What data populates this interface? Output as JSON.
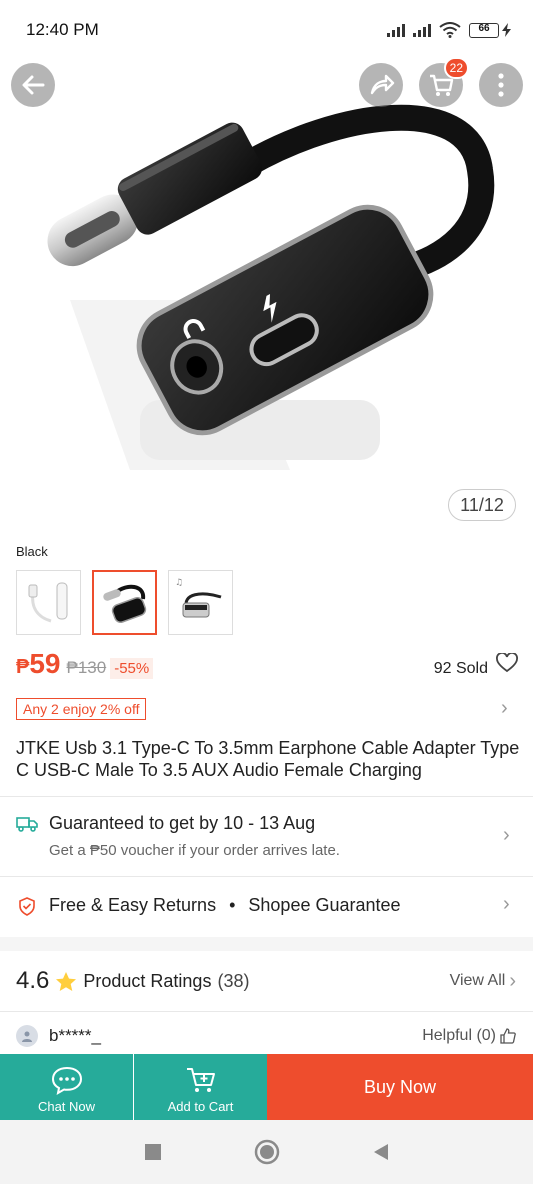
{
  "status_bar": {
    "time": "12:40 PM",
    "battery": "66"
  },
  "hero": {
    "cart_count": "22",
    "image_counter": "11/12",
    "image_subject": "usb-c to 3.5mm audio adapter with charging port (black)"
  },
  "variant": {
    "label": "Black",
    "options": [
      "white",
      "black",
      "silver"
    ],
    "selected_index": 1
  },
  "price": {
    "currency": "₱",
    "current": "59",
    "original": "₱130",
    "discount": "-55%",
    "sold": "92 Sold"
  },
  "promo": {
    "text": "Any 2 enjoy 2% off"
  },
  "product": {
    "title": "JTKE Usb 3.1 Type-C To 3.5mm Earphone Cable Adapter Type C USB-C Male To 3.5 AUX Audio Female Charging"
  },
  "shipping": {
    "title": "Guaranteed to get by 10 - 13 Aug",
    "subtitle": "Get a ₱50 voucher if your order arrives late."
  },
  "returns": {
    "text": "Free & Easy Returns",
    "separator": "•",
    "guarantee": "Shopee Guarantee"
  },
  "ratings": {
    "score": "4.6",
    "title": "Product Ratings",
    "count": "(38)",
    "view_all": "View All"
  },
  "review": {
    "user": "b*****_",
    "helpful": "Helpful (0)"
  },
  "action_bar": {
    "chat_label": "Chat Now",
    "cart_label": "Add to Cart",
    "buy_label": "Buy Now"
  },
  "colors": {
    "brand_orange": "#ee4d2d",
    "teal": "#26ab9a"
  }
}
